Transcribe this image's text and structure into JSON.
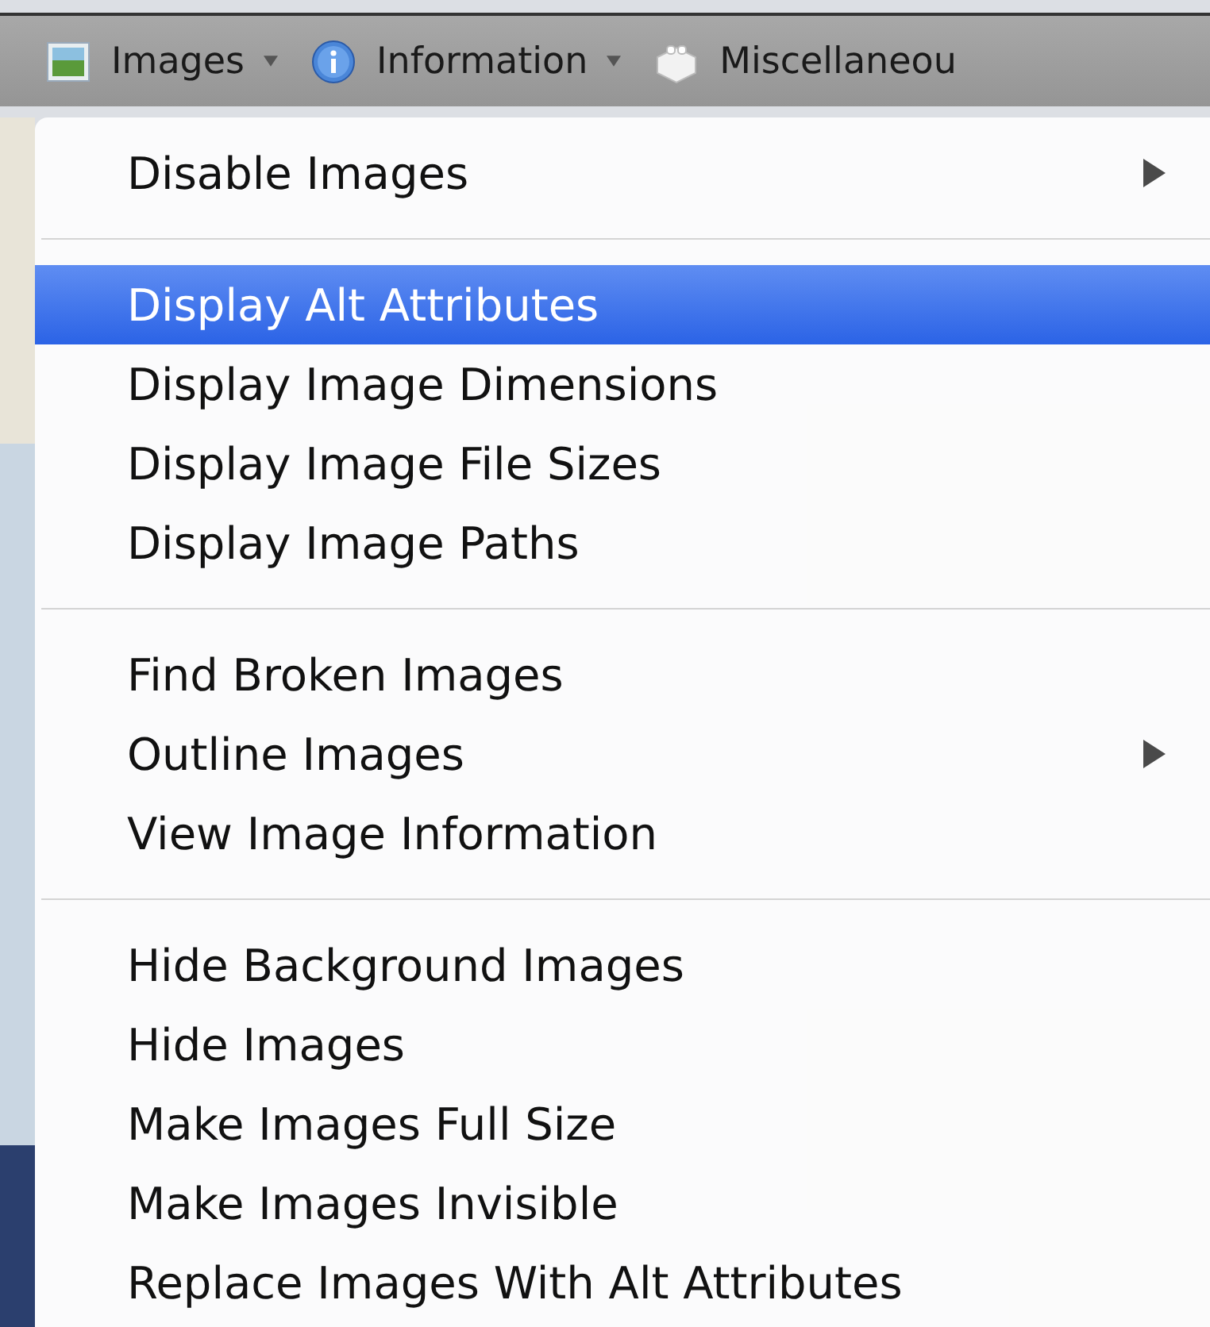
{
  "toolbar": {
    "items": [
      {
        "kind": "picture",
        "label": "Images"
      },
      {
        "kind": "info",
        "label": "Information"
      },
      {
        "kind": "blocks",
        "label": "Miscellaneou"
      }
    ]
  },
  "menu": {
    "sections": [
      [
        {
          "label": "Disable Images",
          "selected": false,
          "submenu": true
        }
      ],
      [
        {
          "label": "Display Alt Attributes",
          "selected": true,
          "submenu": false
        },
        {
          "label": "Display Image Dimensions",
          "selected": false,
          "submenu": false
        },
        {
          "label": "Display Image File Sizes",
          "selected": false,
          "submenu": false
        },
        {
          "label": "Display Image Paths",
          "selected": false,
          "submenu": false
        }
      ],
      [
        {
          "label": "Find Broken Images",
          "selected": false,
          "submenu": false
        },
        {
          "label": "Outline Images",
          "selected": false,
          "submenu": true
        },
        {
          "label": "View Image Information",
          "selected": false,
          "submenu": false
        }
      ],
      [
        {
          "label": "Hide Background Images",
          "selected": false,
          "submenu": false
        },
        {
          "label": "Hide Images",
          "selected": false,
          "submenu": false
        },
        {
          "label": "Make Images Full Size",
          "selected": false,
          "submenu": false
        },
        {
          "label": "Make Images Invisible",
          "selected": false,
          "submenu": false
        },
        {
          "label": "Replace Images With Alt Attributes",
          "selected": false,
          "submenu": false
        }
      ]
    ]
  }
}
